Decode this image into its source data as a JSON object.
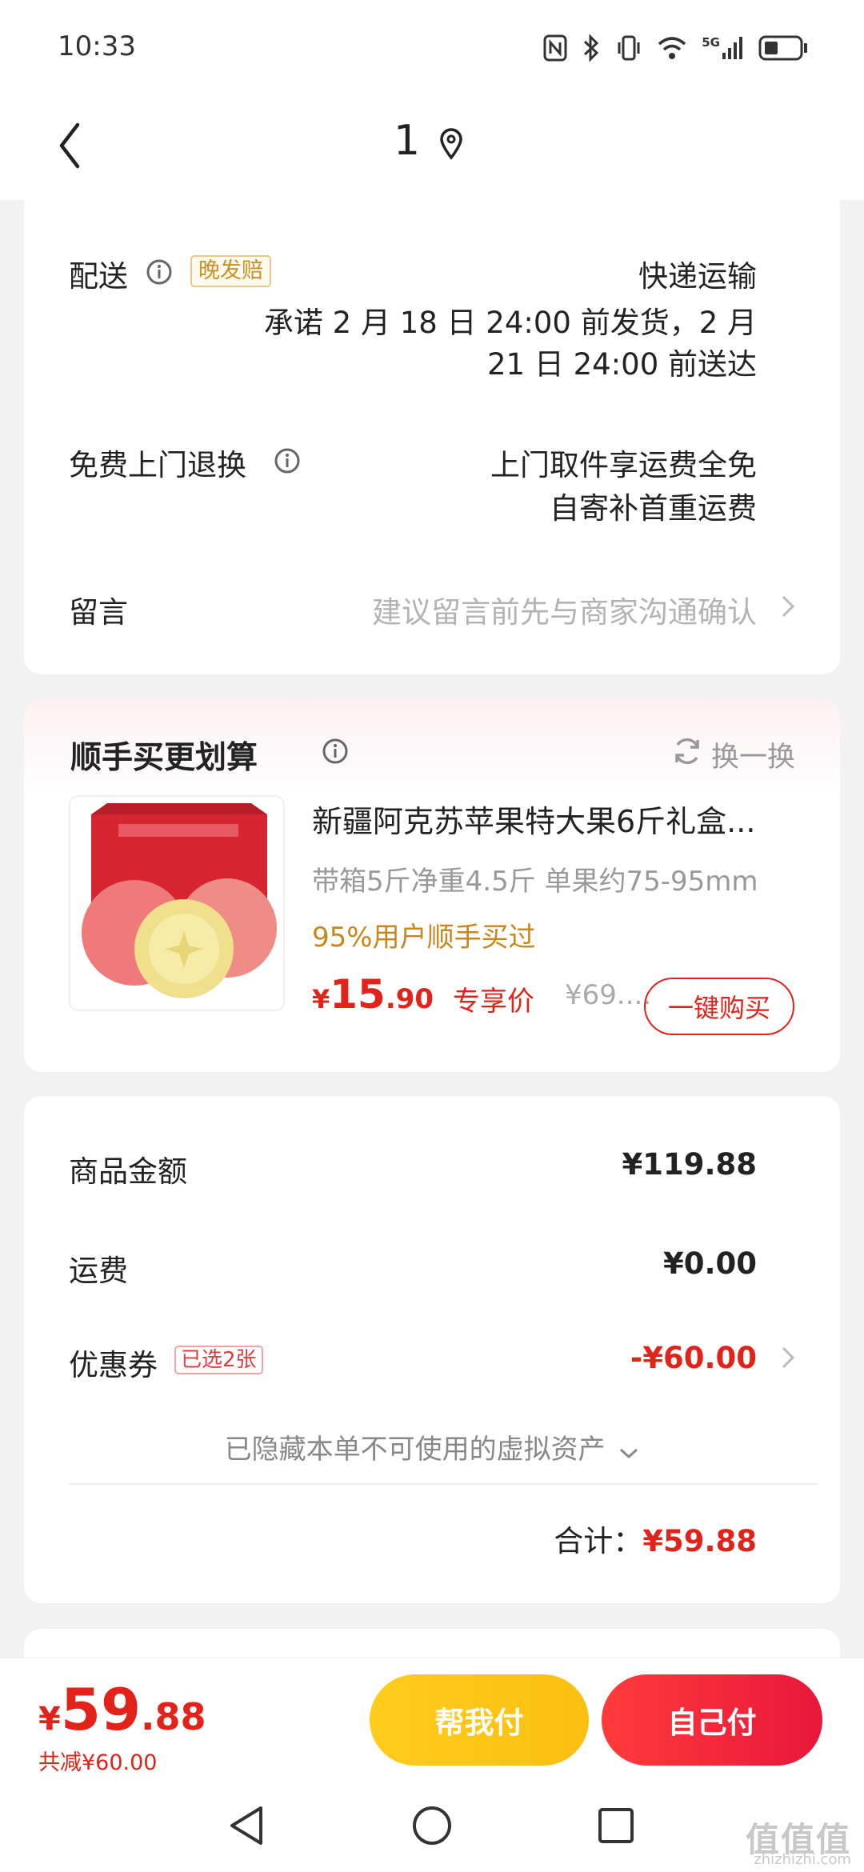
{
  "status_bar": {
    "time": "10:33",
    "network": "5G",
    "icons": [
      "nfc-icon",
      "bluetooth-icon",
      "vibrate-icon",
      "wifi-icon",
      "signal-icon",
      "battery-icon"
    ]
  },
  "nav": {
    "title": "1",
    "icons": [
      "back-arrow-icon",
      "location-pin-icon"
    ]
  },
  "delivery": {
    "label": "配送",
    "badge": "晚发赔",
    "method": "快递运输",
    "promise_line1": "承诺 2 月 18 日 24:00 前发货，2 月",
    "promise_line2": "21 日 24:00 前送达"
  },
  "returns": {
    "label": "免费上门退换",
    "line1": "上门取件享运费全免",
    "line2": "自寄补首重运费"
  },
  "message": {
    "label": "留言",
    "placeholder": "建议留言前先与商家沟通确认"
  },
  "upsell": {
    "title": "顺手买更划算",
    "swap_label": "换一换",
    "product": {
      "title": "新疆阿克苏苹果特大果6斤礼盒...",
      "spec": "带箱5斤净重4.5斤 单果约75-95mm",
      "social_proof": "95%用户顺手买过",
      "price_currency": "¥",
      "price_int": "15",
      "price_dec": ".90",
      "price_tag": "专享价",
      "original_price": "¥69....",
      "buy_label": "一键购买"
    }
  },
  "summary": {
    "goods_label": "商品金额",
    "goods_value": "¥119.88",
    "shipping_label": "运费",
    "shipping_value": "¥0.00",
    "coupon_label": "优惠券",
    "coupon_badge": "已选2张",
    "coupon_value": "-¥60.00",
    "hidden_assets": "已隐藏本单不可使用的虚拟资产",
    "total_label": "合计：",
    "total_value": "¥59.88"
  },
  "bottom_bar": {
    "currency": "¥",
    "price_int": "59",
    "price_dec": ".88",
    "saved": "共减¥60.00",
    "help_pay": "帮我付",
    "self_pay": "自己付"
  },
  "system_nav": {
    "icons": [
      "back-triangle-icon",
      "home-circle-icon",
      "recents-square-icon"
    ],
    "watermark": "值值值",
    "watermark_sub": "zhizhizhi.com"
  },
  "colors": {
    "accent_red": "#e2231a",
    "accent_yellow": "#ffcc1e",
    "badge_orange": "#c89320"
  }
}
